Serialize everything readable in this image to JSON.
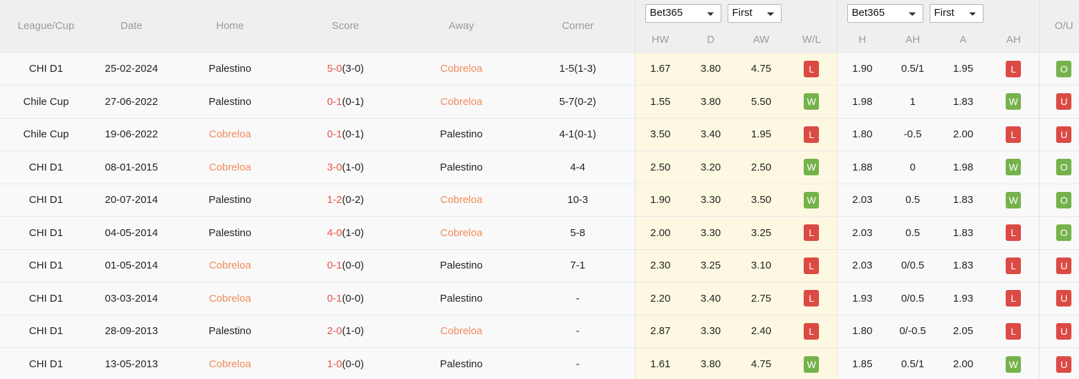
{
  "table": {
    "headers": {
      "league_cup": "League/Cup",
      "date": "Date",
      "home": "Home",
      "score": "Score",
      "away": "Away",
      "corner": "Corner",
      "hw": "HW",
      "d": "D",
      "aw": "AW",
      "wl": "W/L",
      "h": "H",
      "ah1": "AH",
      "a": "A",
      "ah2": "AH",
      "ou": "O/U"
    },
    "selectors": {
      "group1_bookmaker": "Bet365",
      "group1_period": "First",
      "group2_bookmaker": "Bet365",
      "group2_period": "First",
      "bookmaker_options": [
        "Bet365"
      ],
      "period_options": [
        "First"
      ]
    },
    "colors": {
      "score_accent": "#e8534a",
      "team_highlight": "#f18a5b",
      "win_badge": "#76b24c",
      "loss_badge": "#dc4a44",
      "odds_group1_bg": "#fdf8e1",
      "header_bg": "#efefef",
      "row_bg": "#f9f9f9"
    },
    "rows": [
      {
        "league": "CHI D1",
        "date": "25-02-2024",
        "home": "Palestino",
        "home_highlight": false,
        "score_main": "5-0",
        "score_ht": "(3-0)",
        "away": "Cobreloa",
        "away_highlight": true,
        "corner": "1-5(1-3)",
        "hw": "1.67",
        "d": "3.80",
        "aw": "4.75",
        "wl": "L",
        "h": "1.90",
        "ah1": "0.5/1",
        "a": "1.95",
        "ah2": "L",
        "ou": "O"
      },
      {
        "league": "Chile Cup",
        "date": "27-06-2022",
        "home": "Palestino",
        "home_highlight": false,
        "score_main": "0-1",
        "score_ht": "(0-1)",
        "away": "Cobreloa",
        "away_highlight": true,
        "corner": "5-7(0-2)",
        "hw": "1.55",
        "d": "3.80",
        "aw": "5.50",
        "wl": "W",
        "h": "1.98",
        "ah1": "1",
        "a": "1.83",
        "ah2": "W",
        "ou": "U"
      },
      {
        "league": "Chile Cup",
        "date": "19-06-2022",
        "home": "Cobreloa",
        "home_highlight": true,
        "score_main": "0-1",
        "score_ht": "(0-1)",
        "away": "Palestino",
        "away_highlight": false,
        "corner": "4-1(0-1)",
        "hw": "3.50",
        "d": "3.40",
        "aw": "1.95",
        "wl": "L",
        "h": "1.80",
        "ah1": "-0.5",
        "a": "2.00",
        "ah2": "L",
        "ou": "U"
      },
      {
        "league": "CHI D1",
        "date": "08-01-2015",
        "home": "Cobreloa",
        "home_highlight": true,
        "score_main": "3-0",
        "score_ht": "(1-0)",
        "away": "Palestino",
        "away_highlight": false,
        "corner": "4-4",
        "hw": "2.50",
        "d": "3.20",
        "aw": "2.50",
        "wl": "W",
        "h": "1.88",
        "ah1": "0",
        "a": "1.98",
        "ah2": "W",
        "ou": "O"
      },
      {
        "league": "CHI D1",
        "date": "20-07-2014",
        "home": "Palestino",
        "home_highlight": false,
        "score_main": "1-2",
        "score_ht": "(0-2)",
        "away": "Cobreloa",
        "away_highlight": true,
        "corner": "10-3",
        "hw": "1.90",
        "d": "3.30",
        "aw": "3.50",
        "wl": "W",
        "h": "2.03",
        "ah1": "0.5",
        "a": "1.83",
        "ah2": "W",
        "ou": "O"
      },
      {
        "league": "CHI D1",
        "date": "04-05-2014",
        "home": "Palestino",
        "home_highlight": false,
        "score_main": "4-0",
        "score_ht": "(1-0)",
        "away": "Cobreloa",
        "away_highlight": true,
        "corner": "5-8",
        "hw": "2.00",
        "d": "3.30",
        "aw": "3.25",
        "wl": "L",
        "h": "2.03",
        "ah1": "0.5",
        "a": "1.83",
        "ah2": "L",
        "ou": "O"
      },
      {
        "league": "CHI D1",
        "date": "01-05-2014",
        "home": "Cobreloa",
        "home_highlight": true,
        "score_main": "0-1",
        "score_ht": "(0-0)",
        "away": "Palestino",
        "away_highlight": false,
        "corner": "7-1",
        "hw": "2.30",
        "d": "3.25",
        "aw": "3.10",
        "wl": "L",
        "h": "2.03",
        "ah1": "0/0.5",
        "a": "1.83",
        "ah2": "L",
        "ou": "U"
      },
      {
        "league": "CHI D1",
        "date": "03-03-2014",
        "home": "Cobreloa",
        "home_highlight": true,
        "score_main": "0-1",
        "score_ht": "(0-0)",
        "away": "Palestino",
        "away_highlight": false,
        "corner": "-",
        "hw": "2.20",
        "d": "3.40",
        "aw": "2.75",
        "wl": "L",
        "h": "1.93",
        "ah1": "0/0.5",
        "a": "1.93",
        "ah2": "L",
        "ou": "U"
      },
      {
        "league": "CHI D1",
        "date": "28-09-2013",
        "home": "Palestino",
        "home_highlight": false,
        "score_main": "2-0",
        "score_ht": "(1-0)",
        "away": "Cobreloa",
        "away_highlight": true,
        "corner": "-",
        "hw": "2.87",
        "d": "3.30",
        "aw": "2.40",
        "wl": "L",
        "h": "1.80",
        "ah1": "0/-0.5",
        "a": "2.05",
        "ah2": "L",
        "ou": "U"
      },
      {
        "league": "CHI D1",
        "date": "13-05-2013",
        "home": "Cobreloa",
        "home_highlight": true,
        "score_main": "1-0",
        "score_ht": "(0-0)",
        "away": "Palestino",
        "away_highlight": false,
        "corner": "-",
        "hw": "1.61",
        "d": "3.80",
        "aw": "4.75",
        "wl": "W",
        "h": "1.85",
        "ah1": "0.5/1",
        "a": "2.00",
        "ah2": "W",
        "ou": "U"
      }
    ]
  }
}
